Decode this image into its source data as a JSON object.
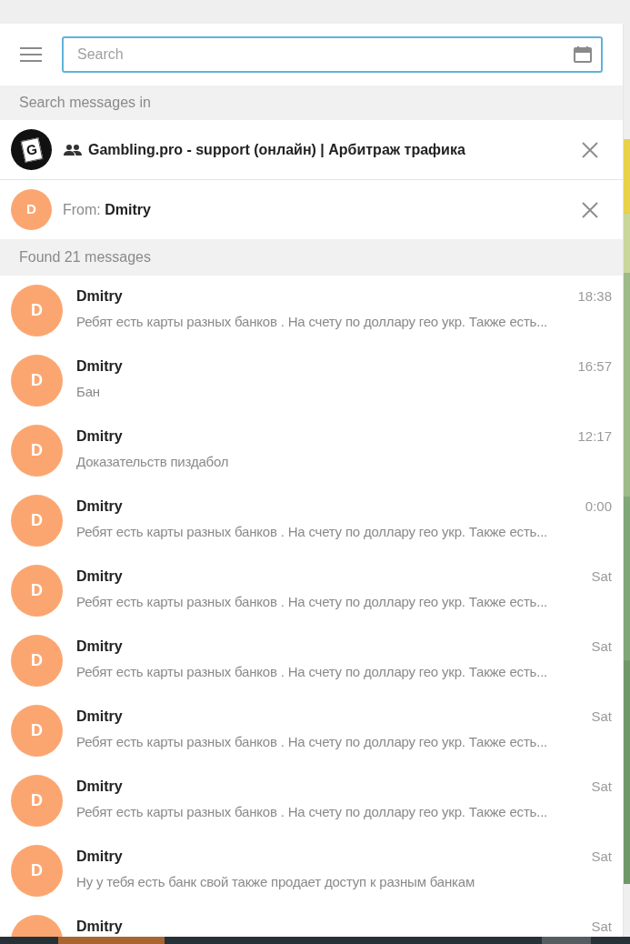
{
  "search": {
    "placeholder": "Search"
  },
  "scope_header": "Search messages in",
  "chat_filter": {
    "logo_letter": "G",
    "name": "Gambling.pro - support (онлайн) | Арбитраж трафика"
  },
  "from_filter": {
    "avatar_letter": "D",
    "label": "From:",
    "name": "Dmitry"
  },
  "results_header": "Found 21 messages",
  "results": [
    {
      "avatar_letter": "D",
      "name": "Dmitry",
      "time": "18:38",
      "text": "Ребят есть карты разных банков . На счету по доллару гео укр. Также есть..."
    },
    {
      "avatar_letter": "D",
      "name": "Dmitry",
      "time": "16:57",
      "text": "Бан"
    },
    {
      "avatar_letter": "D",
      "name": "Dmitry",
      "time": "12:17",
      "text": "Доказательств пиздабол"
    },
    {
      "avatar_letter": "D",
      "name": "Dmitry",
      "time": "0:00",
      "text": "Ребят есть карты разных банков . На счету по доллару гео укр. Также есть..."
    },
    {
      "avatar_letter": "D",
      "name": "Dmitry",
      "time": "Sat",
      "text": "Ребят есть карты разных банков . На счету по доллару гео укр. Также есть..."
    },
    {
      "avatar_letter": "D",
      "name": "Dmitry",
      "time": "Sat",
      "text": "Ребят есть карты разных банков . На счету по доллару гео укр. Также есть..."
    },
    {
      "avatar_letter": "D",
      "name": "Dmitry",
      "time": "Sat",
      "text": "Ребят есть карты разных банков . На счету по доллару гео укр. Также есть..."
    },
    {
      "avatar_letter": "D",
      "name": "Dmitry",
      "time": "Sat",
      "text": "Ребят есть карты разных банков . На счету по доллару гео укр. Также есть..."
    },
    {
      "avatar_letter": "D",
      "name": "Dmitry",
      "time": "Sat",
      "text": "Ну у тебя есть банк свой также продает доступ к разным банкам"
    },
    {
      "name": "Dmitry",
      "time": "Sat"
    }
  ]
}
